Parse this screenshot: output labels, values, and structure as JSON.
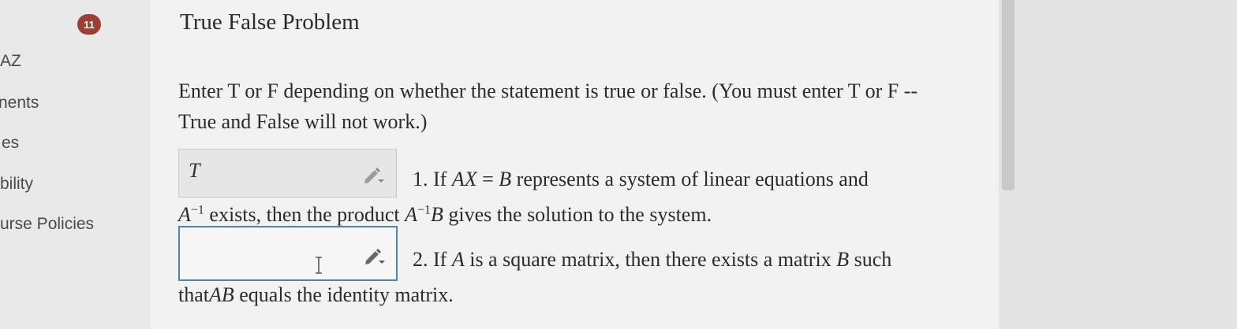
{
  "sidebar": {
    "items": [
      {
        "label": "AZ"
      },
      {
        "label": "nents"
      },
      {
        "label": "es"
      },
      {
        "label": "bility"
      },
      {
        "label": "urse Policies"
      }
    ]
  },
  "problem": {
    "number": "11",
    "title": "True False Problem",
    "instructions": "Enter T or F depending on whether the statement is true or false. (You must enter T or F -- True and False will not work.)"
  },
  "statements": [
    {
      "answer": "T",
      "prefix": "1. If",
      "a": "AX",
      "eq": "=",
      "b": "B",
      "text1": "represents a system of linear equations and",
      "m1": "A",
      "sup1": "−1",
      "text2": "exists, then the product",
      "m2": "A",
      "sup2": "−1",
      "m3": "B",
      "text3": "gives the solution to the system."
    },
    {
      "answer": "",
      "prefix": "2. If",
      "a": "A",
      "text1": "is a square matrix, then there exists a matrix",
      "b": "B",
      "text2": "such",
      "line2a": "that",
      "m1": "AB",
      "line2b": "equals the identity matrix."
    }
  ],
  "icons": {
    "edit": "pencil-edit-icon",
    "cursor": "text-cursor-icon"
  },
  "colors": {
    "badge": "#9c4033",
    "focus_border": "#4f86a8"
  }
}
